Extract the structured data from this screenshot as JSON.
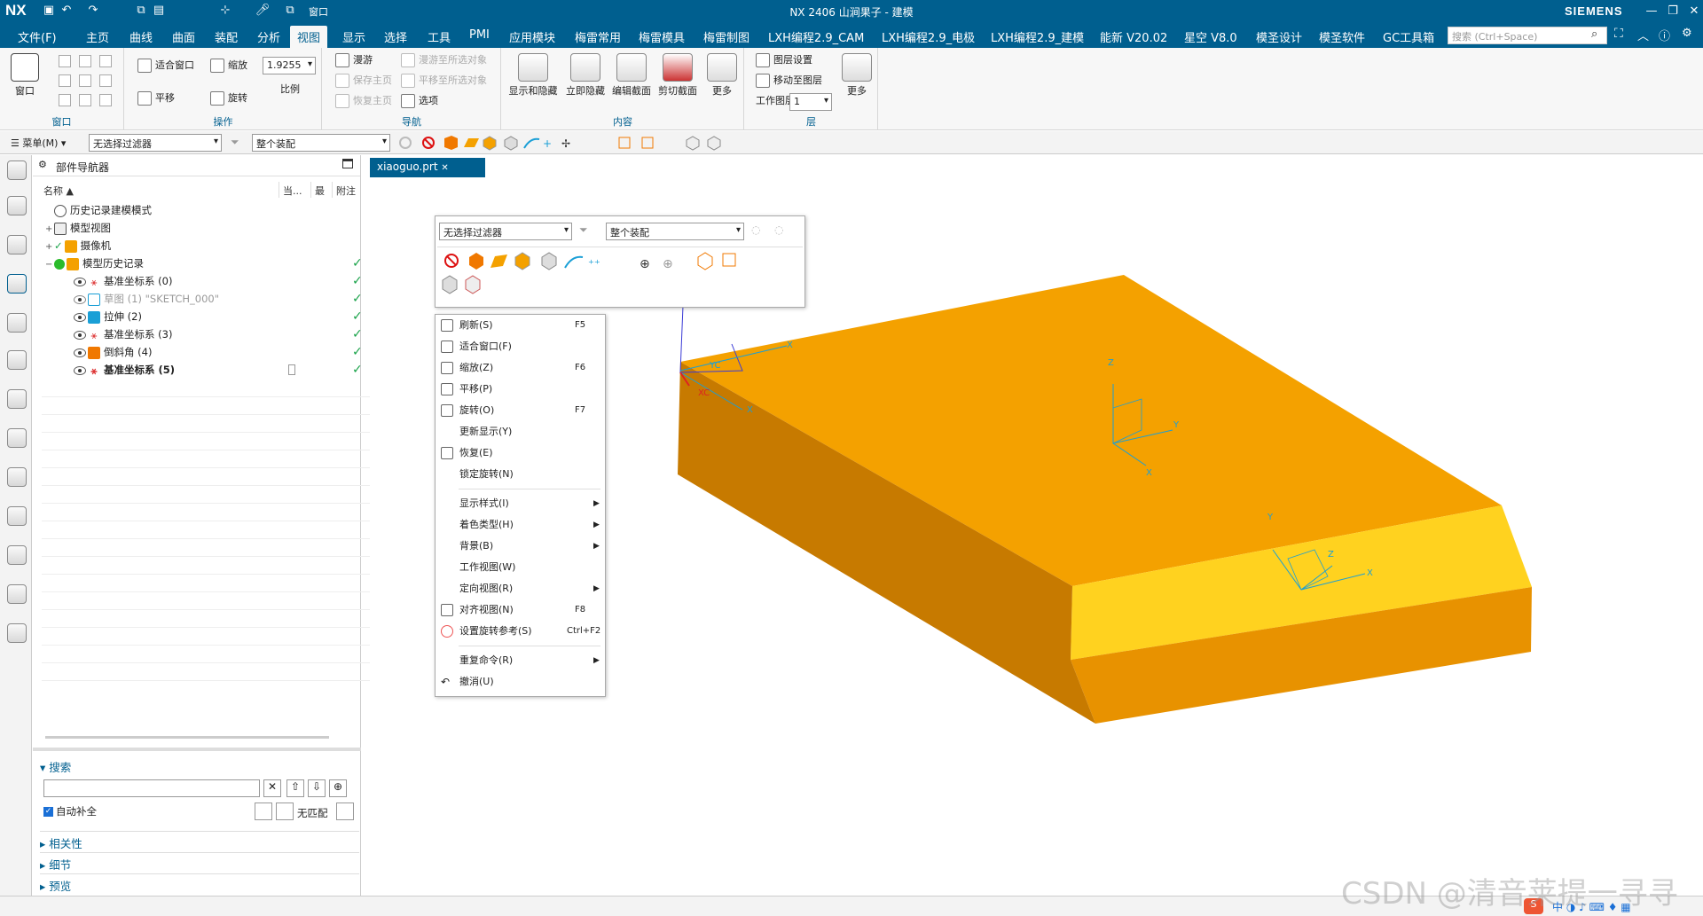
{
  "title": {
    "app": "NX",
    "window_title": "NX 2406 山涧果子 - 建模",
    "brand": "SIEMENS",
    "window_dropdown": "窗口"
  },
  "menubar": {
    "items": [
      "文件(F)",
      "主页",
      "曲线",
      "曲面",
      "装配",
      "分析",
      "视图",
      "显示",
      "选择",
      "工具",
      "PMI",
      "应用模块",
      "梅雷常用",
      "梅雷模具",
      "梅雷制图",
      "LXH编程2.9_CAM",
      "LXH编程2.9_电极",
      "LXH编程2.9_建模",
      "能新 V20.02",
      "星空 V8.0",
      "模圣设计",
      "模圣软件",
      "GC工具箱"
    ],
    "active": "视图",
    "search_placeholder": "搜索 (Ctrl+Space)"
  },
  "ribbon": {
    "window_group": {
      "label": "窗口",
      "button": "窗口"
    },
    "operation_group": {
      "label": "操作",
      "fit": "适合窗口",
      "zoom": "缩放",
      "zoom_value": "1.9255",
      "scale": "比例",
      "pan": "平移",
      "rotate": "旋转"
    },
    "navigation_group": {
      "label": "导航",
      "roam": "漫游",
      "roam_to_selected": "漫游至所选对象",
      "save_home": "保存主页",
      "pan_to_selected": "平移至所选对象",
      "restore_home": "恢复主页",
      "options": "选项"
    },
    "content_group": {
      "label": "内容",
      "show_hide": "显示和隐藏",
      "hide_now": "立即隐藏",
      "edit_section": "编辑截面",
      "clip_section": "剪切截面",
      "more": "更多"
    },
    "layer_group": {
      "label": "层",
      "layer_settings": "图层设置",
      "move_to_layer": "移动至图层",
      "work_layer": "工作图层",
      "work_layer_value": "1",
      "more": "更多"
    }
  },
  "toolbar": {
    "menu": "菜单(M)",
    "filter": "无选择过滤器",
    "assembly": "整个装配"
  },
  "navigator": {
    "title": "部件导航器",
    "columns": {
      "name": "名称",
      "current": "当...",
      "latest": "最",
      "note": "附注"
    },
    "rows": [
      {
        "label": "历史记录建模模式"
      },
      {
        "label": "模型视图"
      },
      {
        "label": "摄像机"
      },
      {
        "label": "模型历史记录"
      },
      {
        "label": "基准坐标系 (0)"
      },
      {
        "label": "草图 (1) \"SKETCH_000\""
      },
      {
        "label": "拉伸 (2)"
      },
      {
        "label": "基准坐标系 (3)"
      },
      {
        "label": "倒斜角 (4)"
      },
      {
        "label": "基准坐标系 (5)"
      }
    ],
    "search": {
      "label": "搜索",
      "auto_complete": "自动补全",
      "no_match": "无匹配"
    },
    "sections": [
      "相关性",
      "细节",
      "预览"
    ]
  },
  "tab": {
    "name": "xiaoguo.prt"
  },
  "context_bar": {
    "filter": "无选择过滤器",
    "assembly": "整个装配"
  },
  "context_menu": [
    {
      "label": "刷新(S)",
      "shortcut": "F5"
    },
    {
      "label": "适合窗口(F)",
      "shortcut": ""
    },
    {
      "label": "缩放(Z)",
      "shortcut": "F6"
    },
    {
      "label": "平移(P)",
      "shortcut": ""
    },
    {
      "label": "旋转(O)",
      "shortcut": "F7"
    },
    {
      "label": "更新显示(Y)",
      "shortcut": ""
    },
    {
      "label": "恢复(E)",
      "shortcut": ""
    },
    {
      "label": "锁定旋转(N)",
      "shortcut": ""
    },
    {
      "label": "显示样式(I)",
      "shortcut": ""
    },
    {
      "label": "着色类型(H)",
      "shortcut": ""
    },
    {
      "label": "背景(B)",
      "shortcut": ""
    },
    {
      "label": "工作视图(W)",
      "shortcut": ""
    },
    {
      "label": "定向视图(R)",
      "shortcut": ""
    },
    {
      "label": "对齐视图(N)",
      "shortcut": "F8"
    },
    {
      "label": "设置旋转参考(S)",
      "shortcut": "Ctrl+F2"
    },
    {
      "label": "重复命令(R)",
      "shortcut": ""
    },
    {
      "label": "撤消(U)",
      "shortcut": ""
    }
  ],
  "viewport_labels": {
    "yc": "YC",
    "xc": "XC",
    "x": "X",
    "y": "Y",
    "z": "Z"
  },
  "watermark": "CSDN @清音莱提一寻寻",
  "colors": {
    "titlebar": "#005f8f",
    "part_top": "#f4a100",
    "part_side": "#c77a00",
    "part_front": "#e89200",
    "chamfer": "#ffd21f",
    "check": "#1aa34a"
  }
}
